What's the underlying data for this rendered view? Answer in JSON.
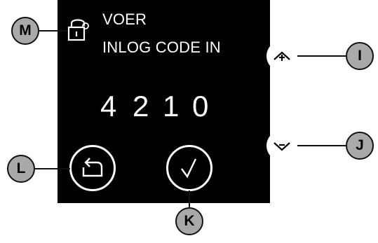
{
  "screen": {
    "title_line1": "VOER",
    "title_line2": "INLOG CODE IN",
    "code_digits": [
      "4",
      "2",
      "1",
      "0"
    ]
  },
  "icons": {
    "lock": "lock-icon",
    "up": "caret-up-plus-icon",
    "down": "caret-down-minus-icon",
    "back": "return-arrow-icon",
    "confirm": "checkmark-icon"
  },
  "callouts": {
    "M": "M",
    "I": "I",
    "J": "J",
    "K": "K",
    "L": "L"
  },
  "colors": {
    "screen_bg": "#000000",
    "text": "#ffffff",
    "callout_fill": "#a9a9a9",
    "callout_border": "#111111"
  }
}
